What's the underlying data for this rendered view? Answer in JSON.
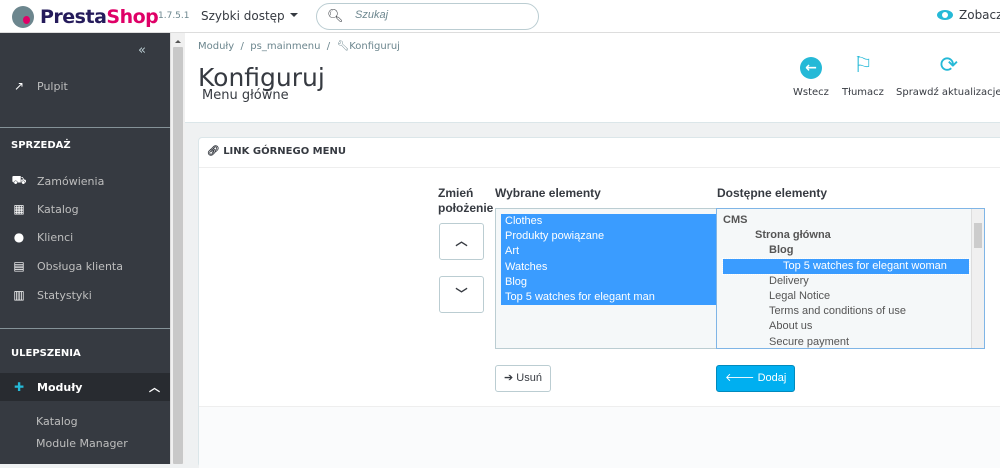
{
  "topbar": {
    "logo_a": "Presta",
    "logo_b": "Shop",
    "version": "1.7.5.1",
    "quick_access": "Szybki dostęp",
    "search_placeholder": "Szukaj",
    "view_shop": "Zobacz"
  },
  "sidebar": {
    "collapse": "«",
    "dashboard": "Pulpit",
    "section_sales": "SPRZEDAŻ",
    "sales": [
      "Zamówienia",
      "Katalog",
      "Klienci",
      "Obsługa klienta",
      "Statystyki"
    ],
    "section_improve": "ULEPSZENIA",
    "modules": "Moduły",
    "modules_sub": [
      "Katalog",
      "Module Manager"
    ]
  },
  "header": {
    "breadcrumb": [
      "Moduły",
      "ps_mainmenu",
      "Konfiguruj"
    ],
    "title": "Konfiguruj",
    "subtitle": "Menu główne",
    "toolbar": [
      "Wstecz",
      "Tłumacz",
      "Sprawdź aktualizacje"
    ]
  },
  "panel": {
    "title": "LINK GÓRNEGO MENU",
    "change_position": "Zmień położenie",
    "selected_label": "Wybrane elementy",
    "available_label": "Dostępne elementy",
    "selected": [
      "Clothes",
      "Produkty powiązane",
      "Art",
      "Watches",
      "Blog",
      "Top 5 watches for elegant man"
    ],
    "available": [
      {
        "t": "CMS",
        "lvl": 0,
        "b": true
      },
      {
        "t": "Strona główna",
        "lvl": 1,
        "b": true
      },
      {
        "t": "Blog",
        "lvl": 2,
        "b": true
      },
      {
        "t": "Top 5 watches for elegant woman",
        "lvl": 3,
        "hl": true
      },
      {
        "t": "Delivery",
        "lvl": 2
      },
      {
        "t": "Legal Notice",
        "lvl": 2
      },
      {
        "t": "Terms and conditions of use",
        "lvl": 2
      },
      {
        "t": "About us",
        "lvl": 2
      },
      {
        "t": "Secure payment",
        "lvl": 2
      }
    ],
    "remove": "Usuń",
    "add": "Dodaj"
  },
  "colors": {
    "accent": "#25b9d7",
    "selection": "#3a9cff",
    "sidebar": "#363a41"
  }
}
